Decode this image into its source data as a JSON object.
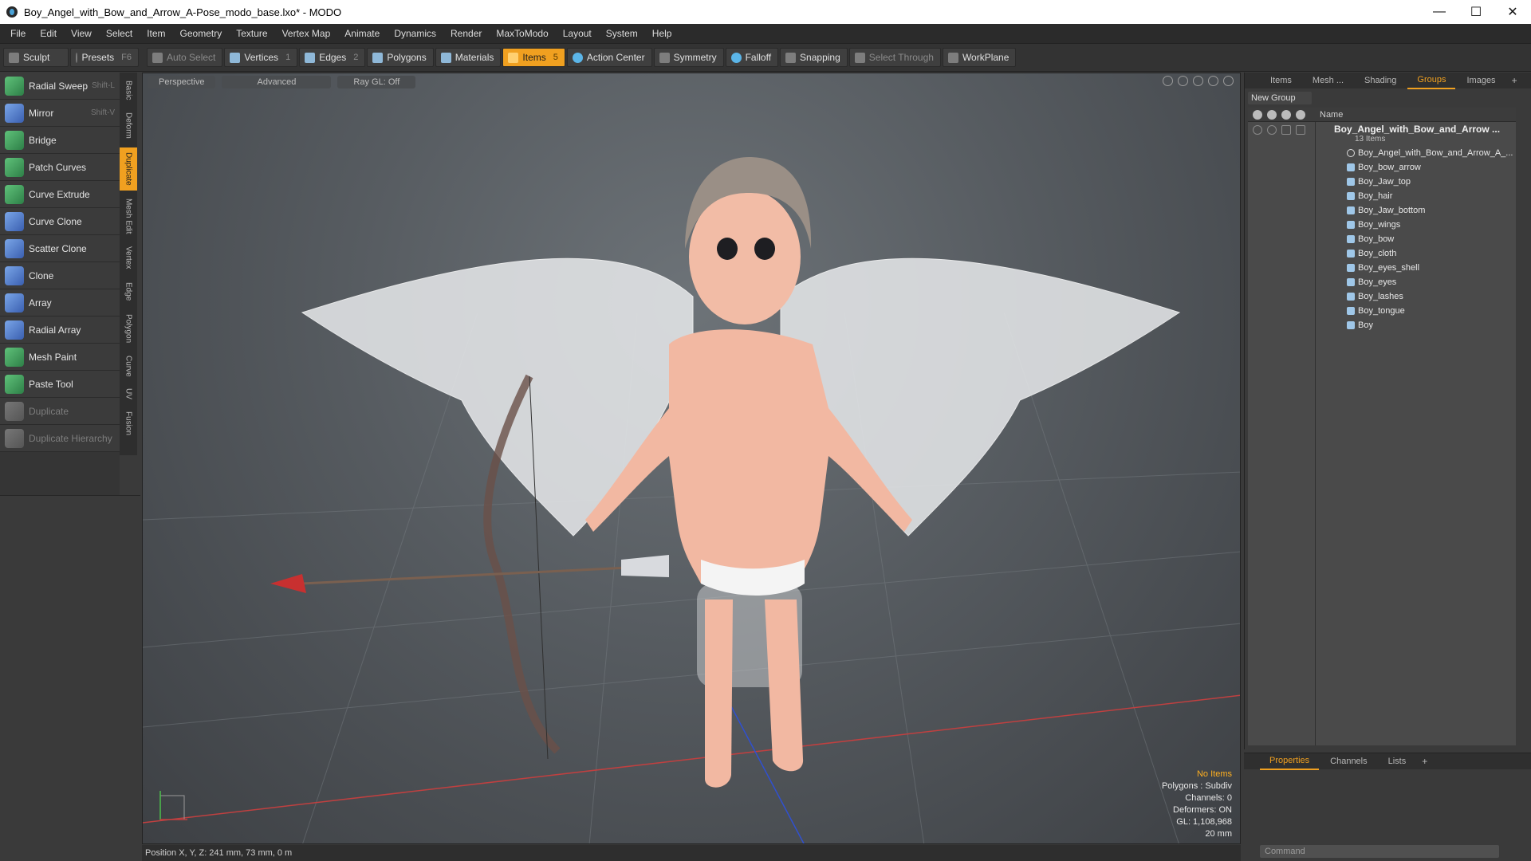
{
  "window": {
    "title": "Boy_Angel_with_Bow_and_Arrow_A-Pose_modo_base.lxo* - MODO",
    "minimize": "—",
    "maximize": "☐",
    "close": "✕"
  },
  "menu": [
    "File",
    "Edit",
    "View",
    "Select",
    "Item",
    "Geometry",
    "Texture",
    "Vertex Map",
    "Animate",
    "Dynamics",
    "Render",
    "MaxToModo",
    "Layout",
    "System",
    "Help"
  ],
  "toolbar": {
    "sculpt": "Sculpt",
    "presets": "Presets",
    "presets_key": "F6",
    "auto_select": "Auto Select",
    "vertices": "Vertices",
    "vertices_key": "1",
    "edges": "Edges",
    "edges_key": "2",
    "polygons": "Polygons",
    "materials": "Materials",
    "items": "Items",
    "items_key": "5",
    "action_center": "Action Center",
    "symmetry": "Symmetry",
    "falloff": "Falloff",
    "snapping": "Snapping",
    "select_through": "Select Through",
    "workplane": "WorkPlane"
  },
  "tools": [
    {
      "label": "Radial Sweep",
      "hotkey": "Shift-L"
    },
    {
      "label": "Mirror",
      "hotkey": "Shift-V"
    },
    {
      "label": "Bridge",
      "hotkey": ""
    },
    {
      "label": "Patch Curves",
      "hotkey": ""
    },
    {
      "label": "Curve Extrude",
      "hotkey": ""
    },
    {
      "label": "Curve Clone",
      "hotkey": ""
    },
    {
      "label": "Scatter Clone",
      "hotkey": ""
    },
    {
      "label": "Clone",
      "hotkey": ""
    },
    {
      "label": "Array",
      "hotkey": ""
    },
    {
      "label": "Radial Array",
      "hotkey": ""
    },
    {
      "label": "Mesh Paint",
      "hotkey": ""
    },
    {
      "label": "Paste Tool",
      "hotkey": ""
    },
    {
      "label": "Duplicate",
      "hotkey": ""
    },
    {
      "label": "Duplicate Hierarchy",
      "hotkey": ""
    }
  ],
  "vtabs": [
    "Basic",
    "Deform",
    "Duplicate",
    "Mesh Edit",
    "Vertex",
    "Edge",
    "Polygon",
    "Curve",
    "UV",
    "Fusion"
  ],
  "viewport": {
    "view": "Perspective",
    "advanced": "Advanced",
    "raygl": "Ray GL: Off",
    "info": {
      "selection": "No Items",
      "polygons": "Polygons : Subdiv",
      "channels": "Channels: 0",
      "deformers": "Deformers: ON",
      "gl": "GL: 1,108,968",
      "scale": "20 mm"
    }
  },
  "status": "Position X, Y, Z:    241 mm, 73 mm, 0 m",
  "rightpanel": {
    "tabs": [
      "Items",
      "Mesh ...",
      "Shading",
      "Groups",
      "Images"
    ],
    "add": "+",
    "new_group": "New Group",
    "name_col": "Name",
    "group_name": "Boy_Angel_with_Bow_and_Arrow ...",
    "group_count": "13 Items",
    "items": [
      "Boy_Angel_with_Bow_and_Arrow_A_...",
      "Boy_bow_arrow",
      "Boy_Jaw_top",
      "Boy_hair",
      "Boy_Jaw_bottom",
      "Boy_wings",
      "Boy_bow",
      "Boy_cloth",
      "Boy_eyes_shell",
      "Boy_eyes",
      "Boy_lashes",
      "Boy_tongue",
      "Boy"
    ]
  },
  "props": {
    "tabs": [
      "Properties",
      "Channels",
      "Lists"
    ],
    "add": "+",
    "command": "Command"
  },
  "colors": {
    "accent": "#f0a020",
    "bg": "#3a3a3a",
    "panel": "#4a4a4a"
  }
}
